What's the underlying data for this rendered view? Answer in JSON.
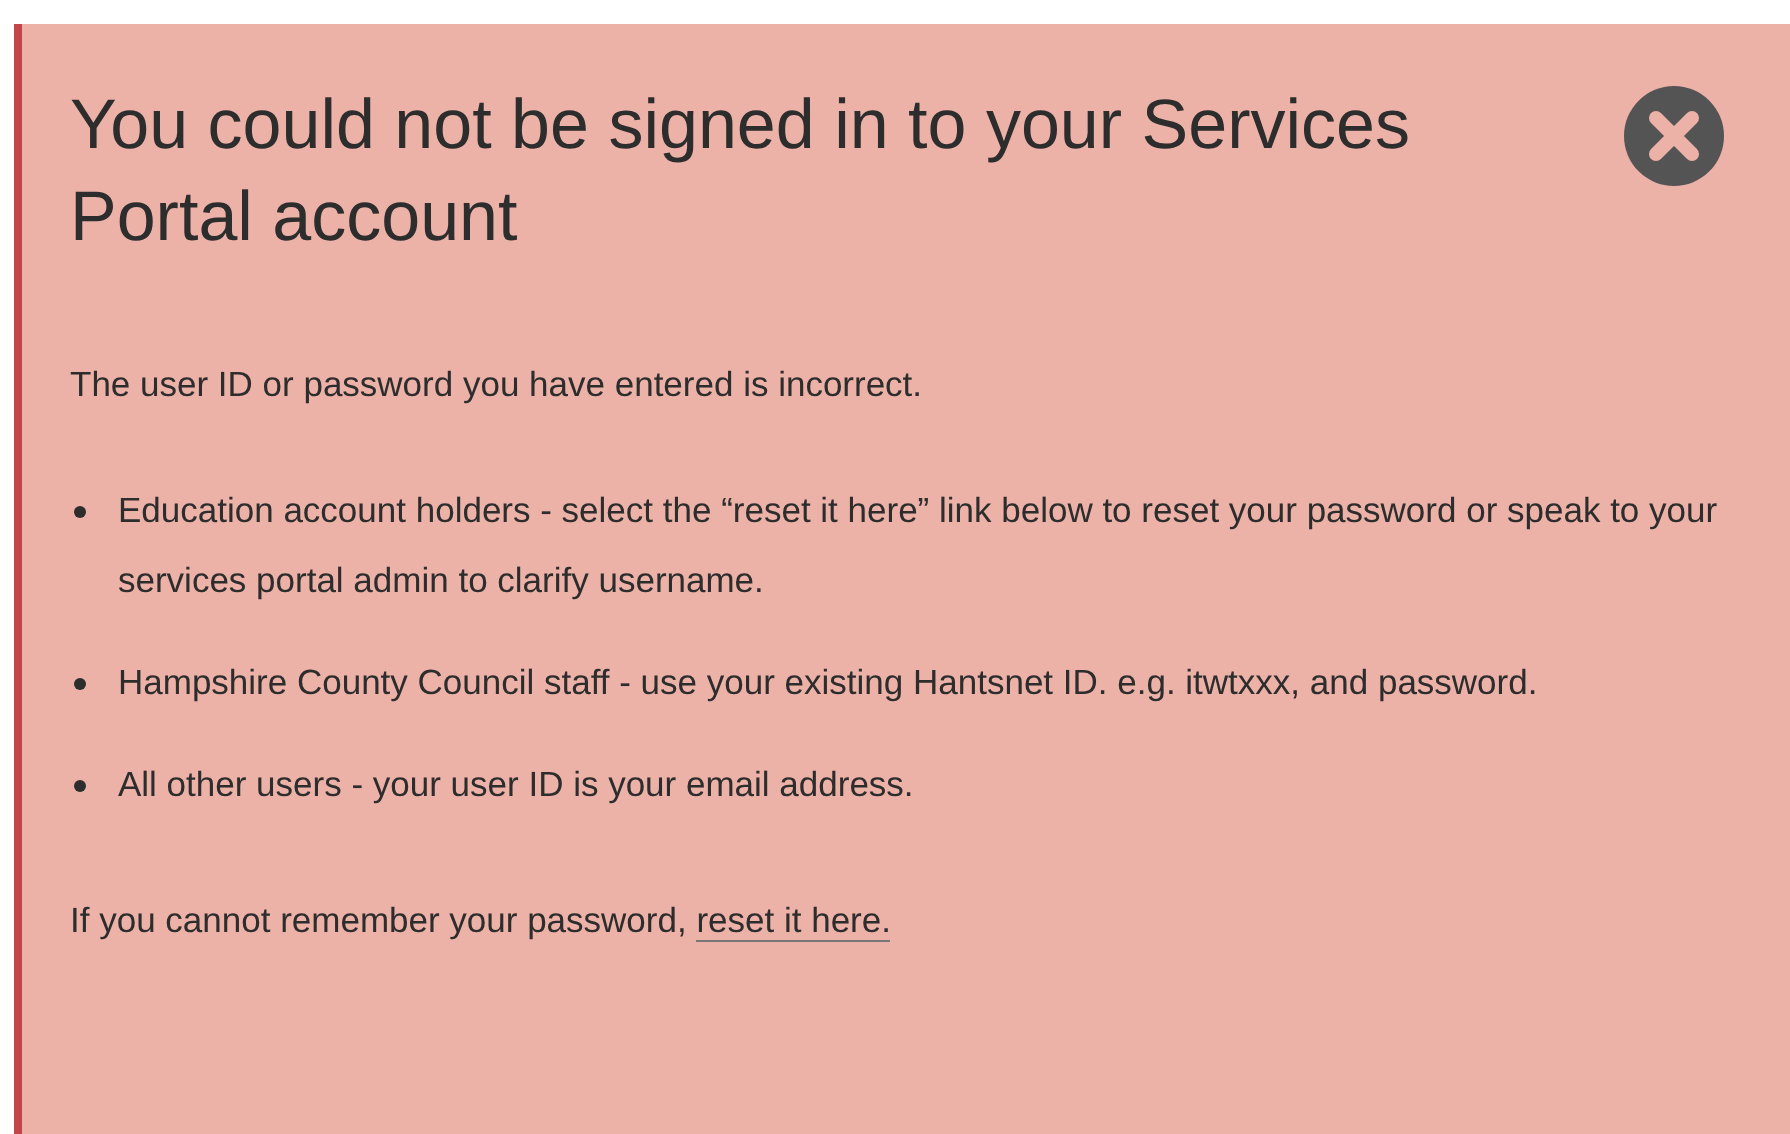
{
  "alert": {
    "title": "You could not be signed in to your Services Portal account",
    "message": "The user ID or password you have entered is incorrect.",
    "items": [
      "Education account holders - select the “reset it here” link below to reset your password or speak to your services portal admin to clarify username.",
      "Hampshire County Council staff - use your existing Hantsnet ID. e.g. itwtxxx, and password.",
      "All other users - your user ID is your email address."
    ],
    "footer_text": "If you cannot remember your password, ",
    "footer_link": "reset it here."
  }
}
